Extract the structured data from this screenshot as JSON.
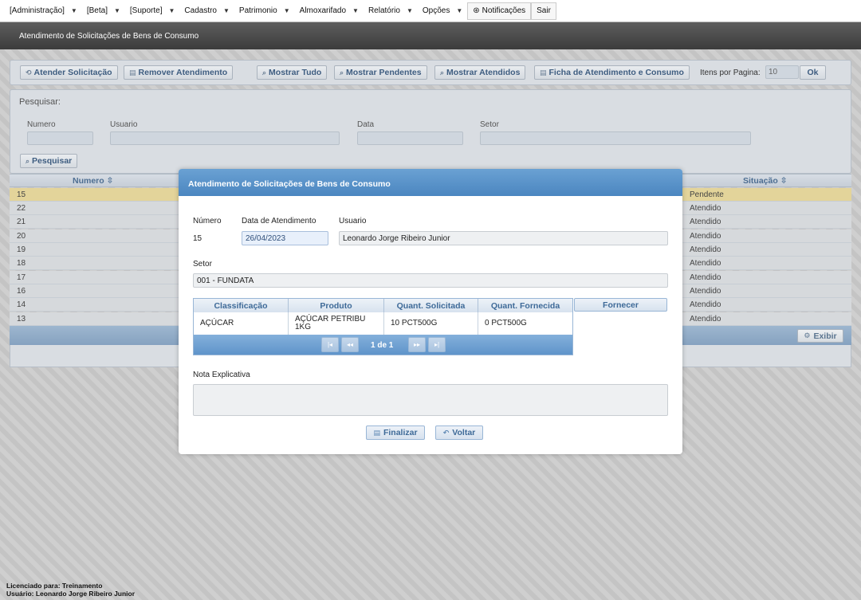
{
  "menu": {
    "items": [
      {
        "label": "[Administração]",
        "caret": true
      },
      {
        "label": "[Beta]",
        "caret": true
      },
      {
        "label": "[Suporte]",
        "caret": true
      },
      {
        "label": "Cadastro",
        "caret": true
      },
      {
        "label": "Patrimonio",
        "caret": true
      },
      {
        "label": "Almoxarifado",
        "caret": true
      },
      {
        "label": "Relatório",
        "caret": true
      },
      {
        "label": "Opções",
        "caret": true
      }
    ],
    "notifications_label": "Notificações",
    "logout_label": "Sair"
  },
  "page": {
    "title": "Atendimento de Solicitações de Bens de Consumo"
  },
  "toolbar": {
    "atender": "Atender Solicitação",
    "remover": "Remover Atendimento",
    "mostrar_tudo": "Mostrar Tudo",
    "mostrar_pendentes": "Mostrar Pendentes",
    "mostrar_atendidos": "Mostrar Atendidos",
    "ficha": "Ficha de Atendimento e Consumo",
    "itens_label": "Itens por Pagina:",
    "itens_value": "10",
    "ok": "Ok"
  },
  "search": {
    "title": "Pesquisar:",
    "numero": "Numero",
    "usuario": "Usuario",
    "data": "Data",
    "setor": "Setor",
    "button": "Pesquisar"
  },
  "grid": {
    "col_numero": "Numero",
    "col_situacao": "Situação",
    "rows": [
      {
        "numero": "15",
        "situacao": "Pendente"
      },
      {
        "numero": "22",
        "situacao": "Atendido"
      },
      {
        "numero": "21",
        "situacao": "Atendido"
      },
      {
        "numero": "20",
        "situacao": "Atendido"
      },
      {
        "numero": "19",
        "situacao": "Atendido"
      },
      {
        "numero": "18",
        "situacao": "Atendido"
      },
      {
        "numero": "17",
        "situacao": "Atendido"
      },
      {
        "numero": "16",
        "situacao": "Atendido"
      },
      {
        "numero": "14",
        "situacao": "Atendido"
      },
      {
        "numero": "13",
        "situacao": "Atendido"
      }
    ],
    "exibir": "Exibir"
  },
  "modal": {
    "title": "Atendimento de Solicitações de Bens de Consumo",
    "numero_label": "Número",
    "numero_value": "15",
    "data_label": "Data de Atendimento",
    "data_value": "26/04/2023",
    "usuario_label": "Usuario",
    "usuario_value": "Leonardo Jorge Ribeiro Junior",
    "setor_label": "Setor",
    "setor_value": "001 - FUNDATA",
    "items": {
      "headers": [
        "Classificação",
        "Produto",
        "Quant. Solicitada",
        "Quant. Fornecida"
      ],
      "rows": [
        {
          "classificacao": "AÇÚCAR",
          "produto_l1": "AÇÚCAR PETRIBU",
          "produto_l2": "1KG",
          "solicitada": "10 PCT500G",
          "fornecida": "0 PCT500G"
        }
      ],
      "pager": "1 de 1"
    },
    "fornecer": "Fornecer",
    "nota_label": "Nota Explicativa",
    "finalizar": "Finalizar",
    "voltar": "Voltar"
  },
  "footer": {
    "licenciado": "Licenciado para: Treinamento",
    "usuario": "Usuário: Leonardo Jorge Ribeiro Junior"
  }
}
